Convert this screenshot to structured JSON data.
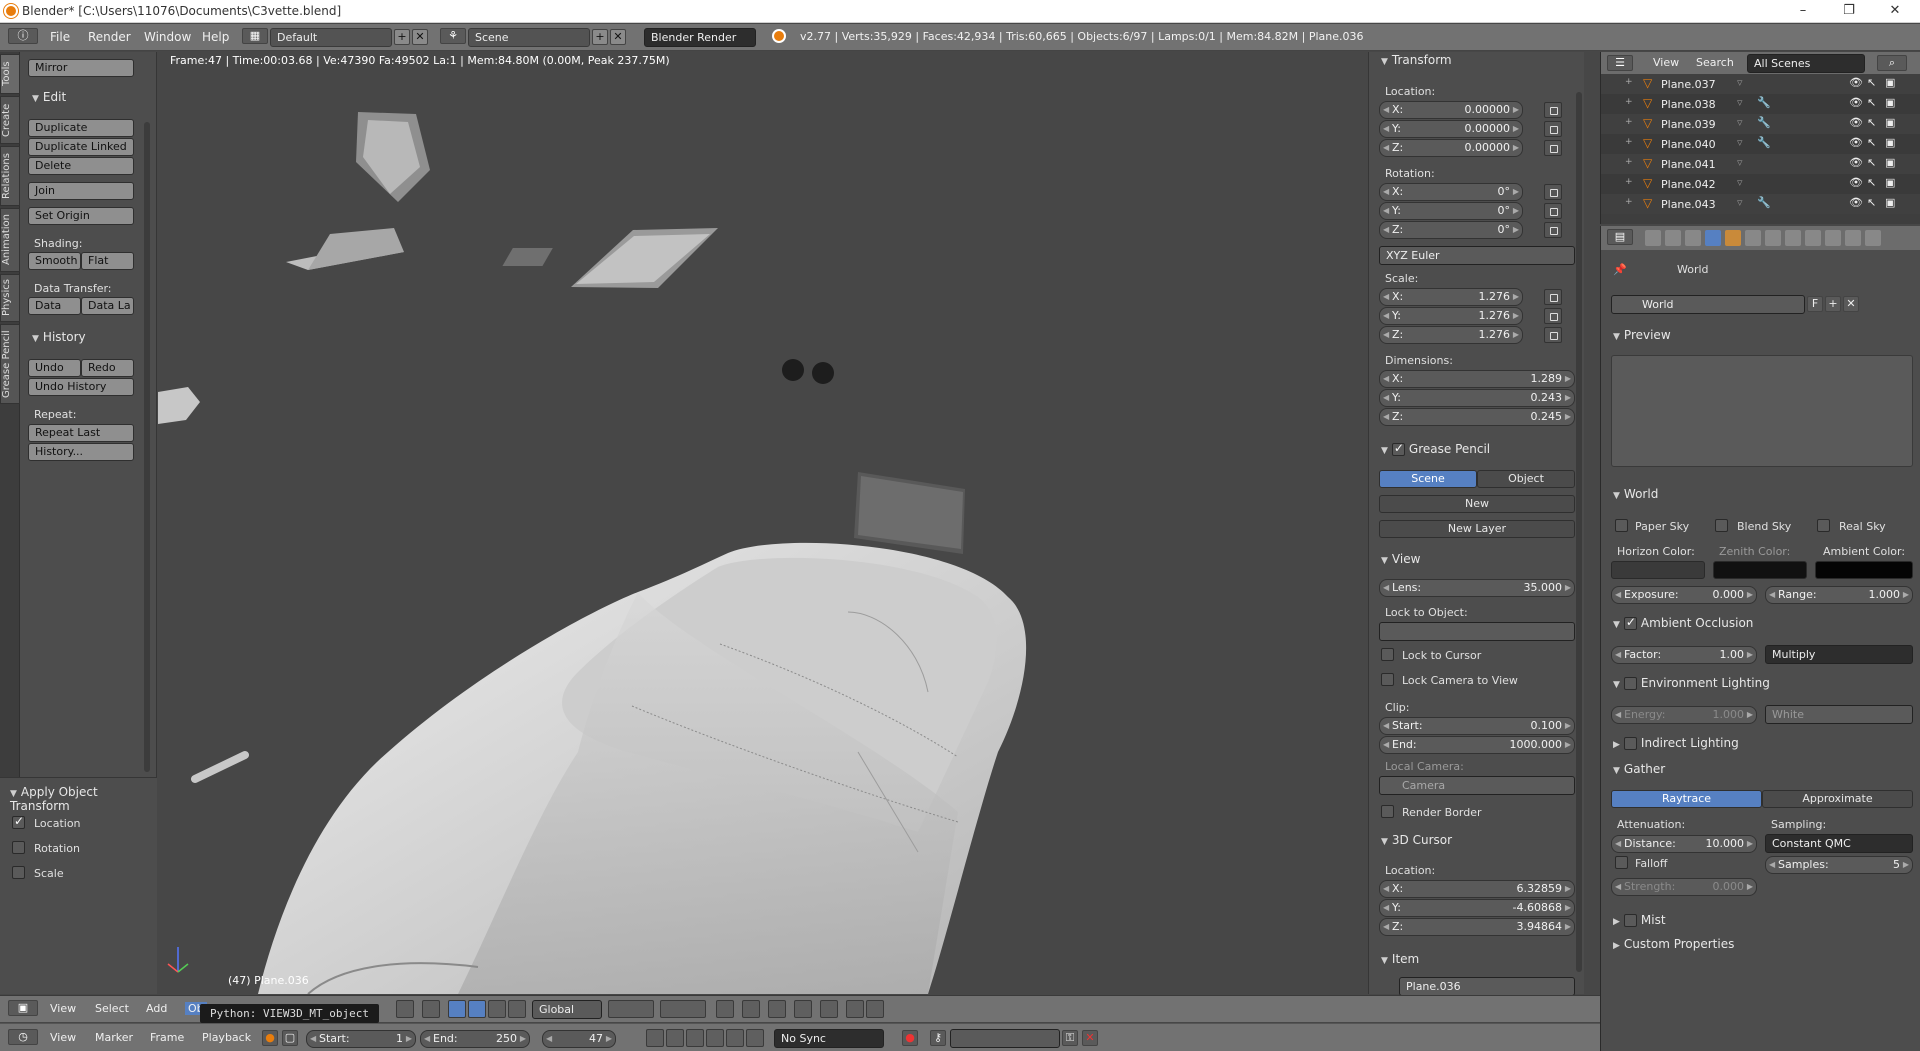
{
  "window": {
    "title": "Blender* [C:\\Users\\11076\\Documents\\C3vette.blend]",
    "controls": [
      "–",
      "❐",
      "✕"
    ]
  },
  "infobar": {
    "menus": [
      "File",
      "Render",
      "Window",
      "Help"
    ],
    "layout": "Default",
    "scene": "Scene",
    "engine": "Blender Render",
    "stats": "v2.77 | Verts:35,929 | Faces:42,934 | Tris:60,665 | Objects:6/97 | Lamps:0/1 | Mem:84.82M | Plane.036"
  },
  "toolshelf": {
    "tabs": [
      "Tools",
      "Create",
      "Relations",
      "Animation",
      "Physics",
      "Grease Pencil"
    ],
    "mirror": "Mirror",
    "edit_title": "Edit",
    "duplicate": "Duplicate",
    "duplicate_linked": "Duplicate Linked",
    "delete": "Delete",
    "join": "Join",
    "set_origin": "Set Origin",
    "shading_label": "Shading:",
    "smooth": "Smooth",
    "flat": "Flat",
    "data_transfer_label": "Data Transfer:",
    "data": "Data",
    "data_la": "Data La",
    "history_title": "History",
    "undo": "Undo",
    "redo": "Redo",
    "undo_history": "Undo History",
    "repeat_label": "Repeat:",
    "repeat_last": "Repeat Last",
    "history_more": "History..."
  },
  "operator": {
    "title": "Apply Object Transform",
    "location": "Location",
    "rotation": "Rotation",
    "scale": "Scale",
    "location_checked": true,
    "rotation_checked": false,
    "scale_checked": false
  },
  "viewport": {
    "info": "Frame:47 | Time:00:03.68 | Ve:47390 Fa:49502 La:1 | Mem:84.80M (0.00M, Peak 237.75M)",
    "object_label": "(47) Plane.036"
  },
  "npanel": {
    "transform_title": "Transform",
    "location_label": "Location:",
    "location": [
      [
        "X:",
        "0.00000"
      ],
      [
        "Y:",
        "0.00000"
      ],
      [
        "Z:",
        "0.00000"
      ]
    ],
    "rotation_label": "Rotation:",
    "rotation": [
      [
        "X:",
        "0°"
      ],
      [
        "Y:",
        "0°"
      ],
      [
        "Z:",
        "0°"
      ]
    ],
    "rotation_mode": "XYZ Euler",
    "scale_label": "Scale:",
    "scale": [
      [
        "X:",
        "1.276"
      ],
      [
        "Y:",
        "1.276"
      ],
      [
        "Z:",
        "1.276"
      ]
    ],
    "dimensions_label": "Dimensions:",
    "dimensions": [
      [
        "X:",
        "1.289"
      ],
      [
        "Y:",
        "0.243"
      ],
      [
        "Z:",
        "0.245"
      ]
    ],
    "grease_pencil_title": "Grease Pencil",
    "gp_scene": "Scene",
    "gp_object": "Object",
    "gp_new": "New",
    "gp_new_layer": "New Layer",
    "view_title": "View",
    "lens_label": "Lens:",
    "lens": "35.000",
    "lock_to_object": "Lock to Object:",
    "lock_to_cursor": "Lock to Cursor",
    "lock_camera": "Lock Camera to View",
    "clip_label": "Clip:",
    "clip_start_label": "Start:",
    "clip_start": "0.100",
    "clip_end_label": "End:",
    "clip_end": "1000.000",
    "local_camera_label": "Local Camera:",
    "local_camera": "Camera",
    "render_border": "Render Border",
    "cursor_title": "3D Cursor",
    "cursor_location_label": "Location:",
    "cursor": [
      [
        "X:",
        "6.32859"
      ],
      [
        "Y:",
        "-4.60868"
      ],
      [
        "Z:",
        "3.94864"
      ]
    ],
    "item_title": "Item",
    "item_name": "Plane.036"
  },
  "outliner": {
    "view": "View",
    "search": "Search",
    "scenes": "All Scenes",
    "rows": [
      "Plane.037",
      "Plane.038",
      "Plane.039",
      "Plane.040",
      "Plane.041",
      "Plane.042",
      "Plane.043"
    ]
  },
  "properties": {
    "breadcrumb": "World",
    "world_name": "World",
    "fake_user": "F",
    "preview_title": "Preview",
    "world_title": "World",
    "paper_sky": "Paper Sky",
    "blend_sky": "Blend Sky",
    "real_sky": "Real Sky",
    "horizon_color": "Horizon Color:",
    "zenith_color": "Zenith Color:",
    "ambient_color": "Ambient Color:",
    "exposure_label": "Exposure:",
    "exposure": "0.000",
    "range_label": "Range:",
    "range": "1.000",
    "ao_title": "Ambient Occlusion",
    "factor_label": "Factor:",
    "factor": "1.00",
    "blend_mode": "Multiply",
    "env_title": "Environment Lighting",
    "energy_label": "Energy:",
    "energy": "1.000",
    "env_color": "White",
    "indirect_title": "Indirect Lighting",
    "gather_title": "Gather",
    "raytrace": "Raytrace",
    "approximate": "Approximate",
    "attenuation_label": "Attenuation:",
    "sampling_label": "Sampling:",
    "distance_label": "Distance:",
    "distance": "10.000",
    "sampling": "Constant QMC",
    "falloff": "Falloff",
    "samples_label": "Samples:",
    "samples": "5",
    "strength_label": "Strength:",
    "strength": "0.000",
    "mist_title": "Mist",
    "custom_props_title": "Custom Properties"
  },
  "vp_header": {
    "menus": [
      "View",
      "Select",
      "Add",
      "Ob"
    ],
    "tooltip": "Python: VIEW3D_MT_object",
    "orientation": "Global"
  },
  "timeline": {
    "menus": [
      "View",
      "Marker",
      "Frame",
      "Playback"
    ],
    "start_label": "Start:",
    "start": "1",
    "end_label": "End:",
    "end": "250",
    "current": "47",
    "sync": "No Sync"
  },
  "colors": {
    "accent_blue": "#5680c2",
    "blender_orange": "#e87d0d"
  }
}
